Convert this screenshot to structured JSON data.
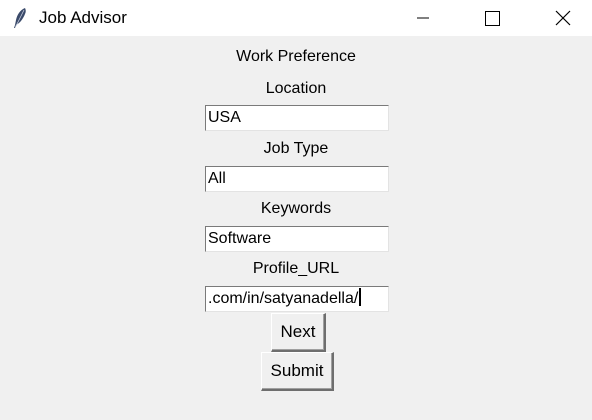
{
  "window": {
    "title": "Job Advisor",
    "icon": "feather-icon",
    "controls": {
      "minimize": "minimize-icon",
      "maximize": "maximize-icon",
      "close": "close-icon"
    }
  },
  "form": {
    "heading": "Work Preference",
    "location": {
      "label": "Location",
      "value": "USA"
    },
    "job_type": {
      "label": "Job Type",
      "value": "All"
    },
    "keywords": {
      "label": "Keywords",
      "value": "Software"
    },
    "profile_url": {
      "label": "Profile_URL",
      "value": ".com/in/satyanadella/"
    }
  },
  "buttons": {
    "next": "Next",
    "submit": "Submit"
  }
}
